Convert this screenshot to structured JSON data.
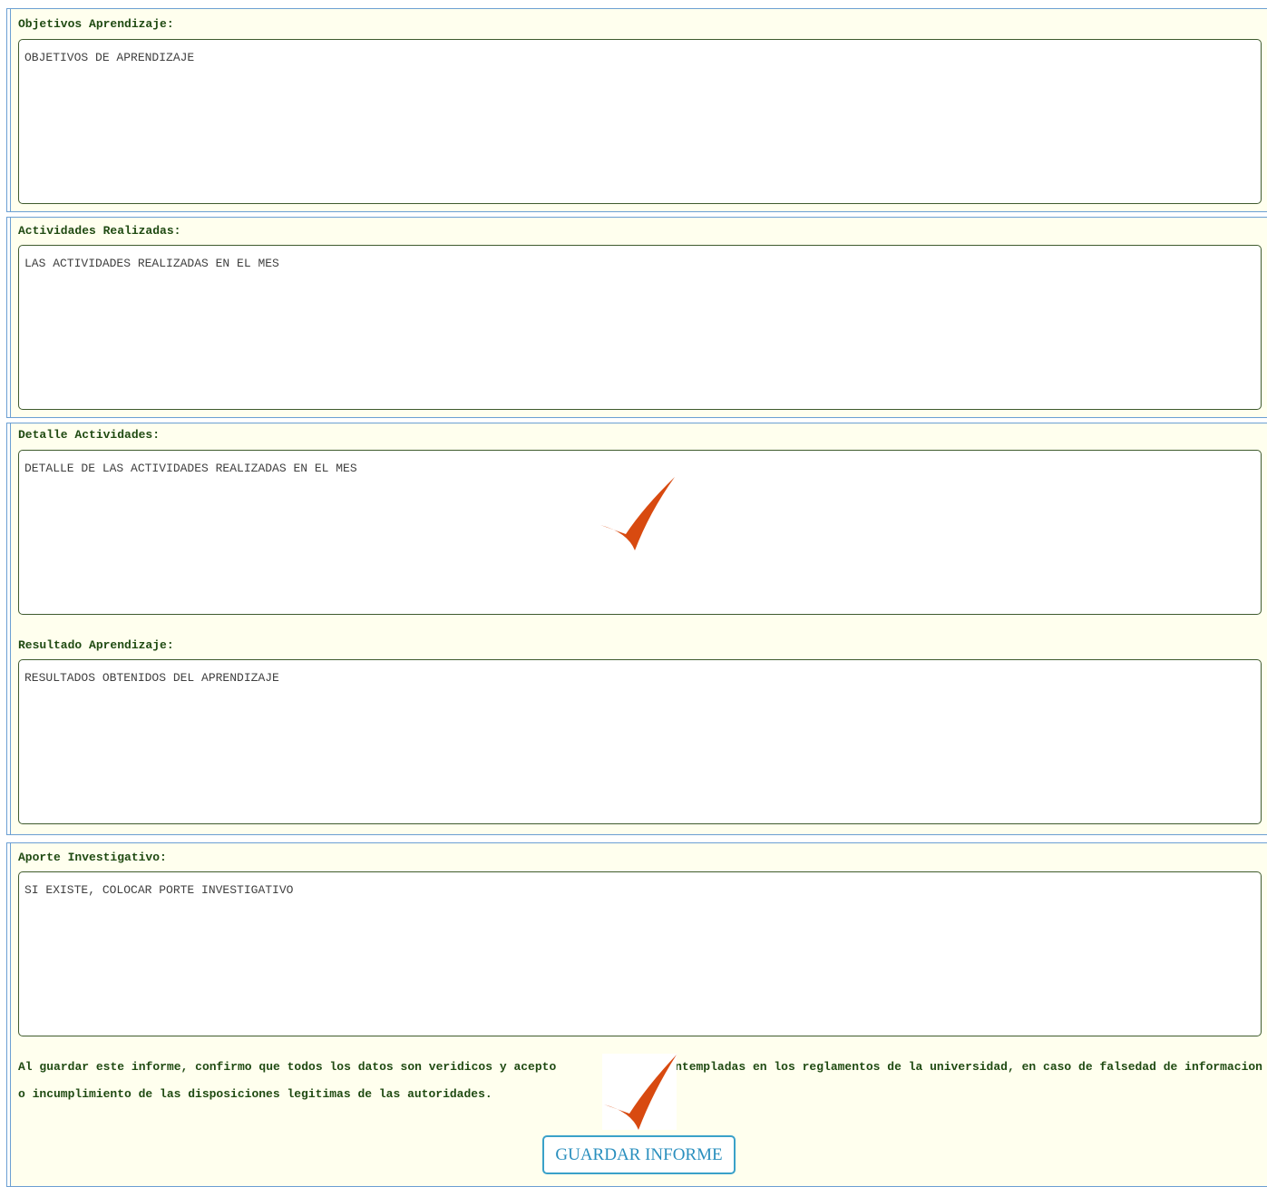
{
  "objetivos": {
    "label": "Objetivos Aprendizaje:",
    "value": "OBJETIVOS DE APRENDIZAJE"
  },
  "actividades": {
    "label": "Actividades Realizadas:",
    "value": "LAS ACTIVIDADES REALIZADAS EN EL MES"
  },
  "detalle": {
    "label": "Detalle Actividades:",
    "value": "DETALLE DE LAS ACTIVIDADES REALIZADAS EN EL MES"
  },
  "resultado": {
    "label": "Resultado Aprendizaje:",
    "value": "RESULTADOS OBTENIDOS DEL APRENDIZAJE"
  },
  "aporte": {
    "label": "Aporte Investigativo:",
    "value": "SI EXISTE, COLOCAR PORTE INVESTIGATIVO"
  },
  "disclaimer": {
    "text_before": "Al guardar este informe, confirmo que todos los datos son veridicos y acepto",
    "text_after": "las contempladas en los reglamentos de la universidad, en caso de falsedad de informacion o incumplimiento de las disposiciones legitimas de las autoridades."
  },
  "save_button_label": "GUARDAR INFORME",
  "colors": {
    "panel_background": "#ffffee",
    "panel_border": "#6b9fd3",
    "label_text": "#1f4a12",
    "textarea_border": "#3f5b2e",
    "button_text": "#2a8fbe",
    "checkmark": "#d84a10"
  },
  "icons": {
    "overlay_check": "checkmark-icon"
  }
}
